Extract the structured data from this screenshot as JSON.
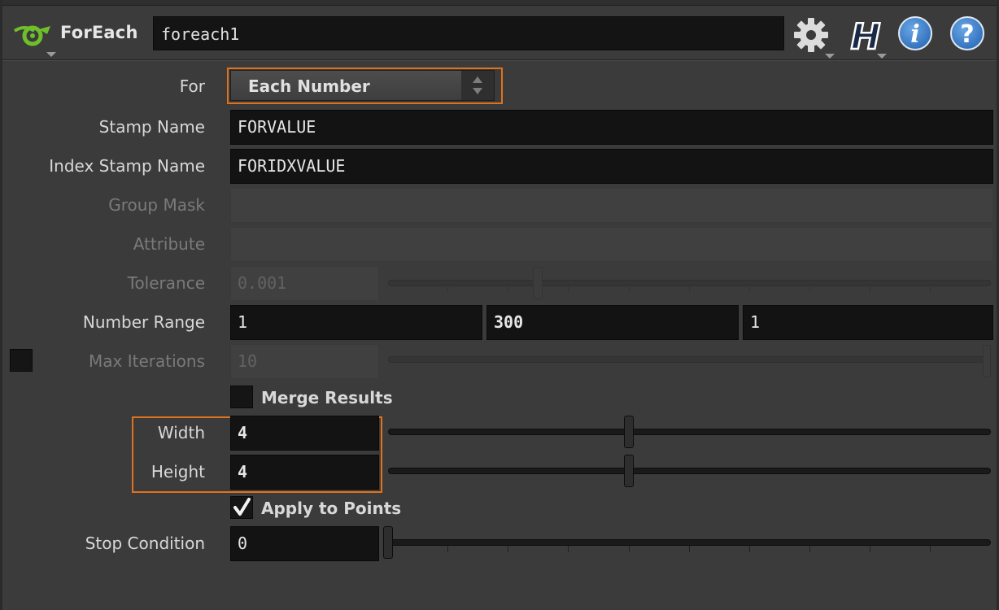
{
  "header": {
    "node_type": "ForEach",
    "node_name": "foreach1",
    "icons": [
      "foreach-node-icon",
      "gear-icon",
      "houdini-h-icon",
      "info-icon",
      "help-icon"
    ]
  },
  "parms": {
    "for": {
      "label": "For",
      "value": "Each Number"
    },
    "stamp_name": {
      "label": "Stamp Name",
      "value": "FORVALUE"
    },
    "index_stamp_name": {
      "label": "Index Stamp Name",
      "value": "FORIDXVALUE"
    },
    "group_mask": {
      "label": "Group Mask",
      "value": ""
    },
    "attribute": {
      "label": "Attribute",
      "value": ""
    },
    "tolerance": {
      "label": "Tolerance",
      "value": "0.001"
    },
    "number_range": {
      "label": "Number Range",
      "values": [
        "1",
        "300",
        "1"
      ]
    },
    "max_iterations": {
      "label": "Max Iterations",
      "value": "10",
      "enabled": false
    },
    "merge_results": {
      "label": "Merge Results",
      "checked": false
    },
    "width": {
      "label": "Width",
      "value": "4"
    },
    "height": {
      "label": "Height",
      "value": "4"
    },
    "apply_to_points": {
      "label": "Apply to Points",
      "checked": true
    },
    "stop_condition": {
      "label": "Stop Condition",
      "value": "0"
    }
  },
  "colors": {
    "highlight": "#e0721c",
    "background": "#3b3b3b",
    "field": "#131313",
    "node_icon": "#6fbf2a",
    "info_blue": "#2f77c8"
  }
}
